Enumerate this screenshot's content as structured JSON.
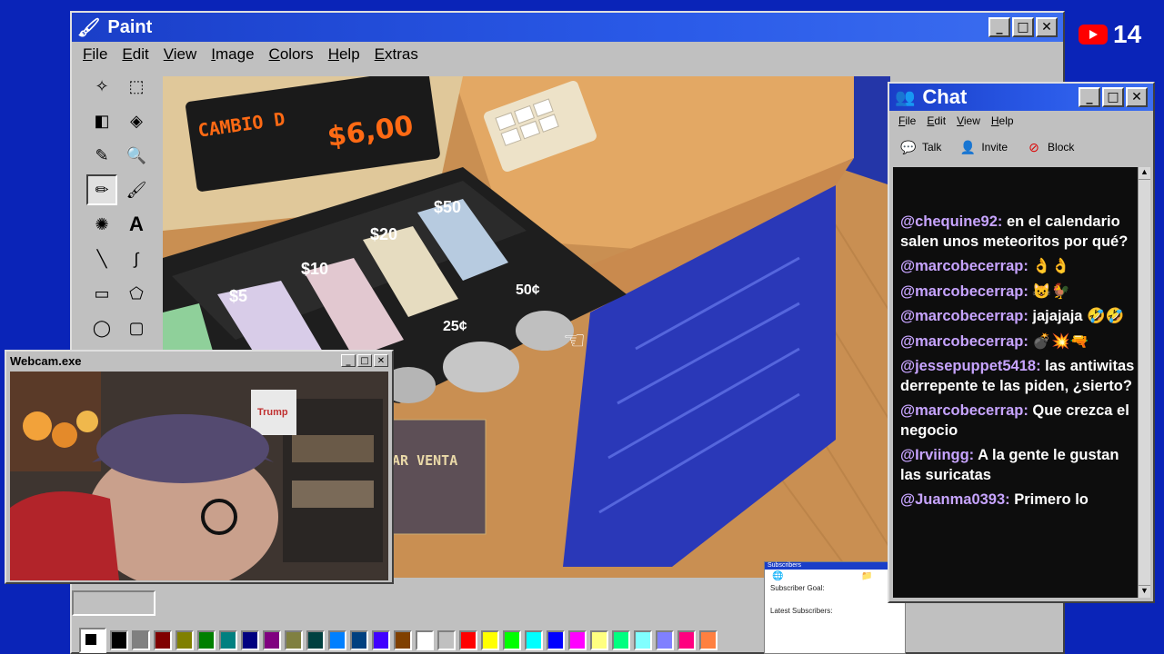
{
  "paint": {
    "title": "Paint",
    "menu": [
      "File",
      "Edit",
      "View",
      "Image",
      "Colors",
      "Help",
      "Extras"
    ],
    "palette": [
      "#000000",
      "#808080",
      "#800000",
      "#808000",
      "#008000",
      "#008080",
      "#000080",
      "#800080",
      "#808040",
      "#004040",
      "#0080ff",
      "#004080",
      "#4000ff",
      "#804000",
      "#ffffff",
      "#c0c0c0",
      "#ff0000",
      "#ffff00",
      "#00ff00",
      "#00ffff",
      "#0000ff",
      "#ff00ff",
      "#ffff80",
      "#00ff80",
      "#80ffff",
      "#8080ff",
      "#ff0080",
      "#ff8040"
    ]
  },
  "game": {
    "display_label": "CAMBIO D",
    "display_amount": "$6,00",
    "bills": [
      "$50",
      "$20",
      "$10",
      "$5"
    ],
    "coins": [
      "50¢",
      "25¢"
    ],
    "button_label": "AR VENTA"
  },
  "webcam": {
    "title": "Webcam.exe",
    "poster_text": "Trump"
  },
  "subscribers": {
    "header": "Subscribers",
    "goal": "Subscriber Goal:",
    "latest": "Latest Subscribers:"
  },
  "chat": {
    "title": "Chat",
    "menu": [
      "File",
      "Edit",
      "View",
      "Help"
    ],
    "toolbar": {
      "talk": "Talk",
      "invite": "Invite",
      "block": "Block"
    },
    "messages": [
      {
        "user": "@chequine92:",
        "text": "en el calendario salen unos meteoritos por qué?"
      },
      {
        "user": "@marcobecerrap:",
        "text": "👌👌"
      },
      {
        "user": "@marcobecerrap:",
        "text": "😺🐓"
      },
      {
        "user": "@marcobecerrap:",
        "text": "jajajaja 🤣🤣"
      },
      {
        "user": "@marcobecerrap:",
        "text": "💣💥🔫"
      },
      {
        "user": "@jessepuppet5418:",
        "text": "las antiwitas derrepente te las piden, ¿sierto?"
      },
      {
        "user": "@marcobecerrap:",
        "text": "Que crezca el negocio"
      },
      {
        "user": "@Irviingg:",
        "text": "A la gente le gustan las suricatas"
      },
      {
        "user": "@Juanma0393:",
        "text": "Primero lo"
      }
    ]
  },
  "youtube": {
    "count": "14"
  }
}
